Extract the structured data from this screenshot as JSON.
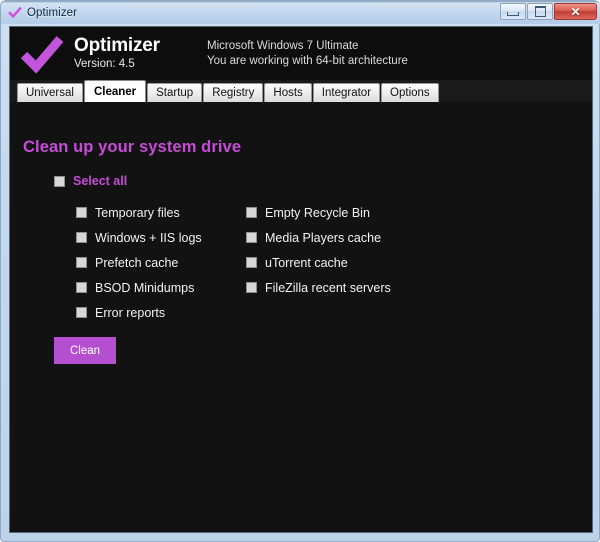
{
  "window": {
    "title": "Optimizer",
    "title_icon": "checkmark-icon",
    "controls": {
      "minimize_label": "Minimize",
      "maximize_label": "Maximize",
      "close_label": "✕"
    }
  },
  "header": {
    "logo_icon": "checkmark-logo-icon",
    "app_name": "Optimizer",
    "version": "Version: 4.5",
    "os_name": "Microsoft Windows 7 Ultimate",
    "architecture": "You are working with 64-bit architecture"
  },
  "tabs": [
    {
      "label": "Universal",
      "active": false
    },
    {
      "label": "Cleaner",
      "active": true
    },
    {
      "label": "Startup",
      "active": false
    },
    {
      "label": "Registry",
      "active": false
    },
    {
      "label": "Hosts",
      "active": false
    },
    {
      "label": "Integrator",
      "active": false
    },
    {
      "label": "Options",
      "active": false
    }
  ],
  "cleaner": {
    "page_title": "Clean up your system drive",
    "select_all_label": "Select all",
    "left_options": [
      {
        "label": "Temporary files",
        "checked": false
      },
      {
        "label": "Windows + IIS logs",
        "checked": false
      },
      {
        "label": "Prefetch cache",
        "checked": false
      },
      {
        "label": "BSOD Minidumps",
        "checked": false
      },
      {
        "label": "Error reports",
        "checked": false
      }
    ],
    "right_options": [
      {
        "label": "Empty Recycle Bin",
        "checked": false
      },
      {
        "label": "Media Players cache",
        "checked": false
      },
      {
        "label": "uTorrent cache",
        "checked": false
      },
      {
        "label": "FileZilla recent servers",
        "checked": false
      }
    ],
    "clean_button_label": "Clean"
  },
  "colors": {
    "accent_purple": "#c64cd8",
    "button_purple": "#b44fd0",
    "app_background": "#121212",
    "header_background": "#0d0d0d",
    "text_light": "#f2f2f2"
  }
}
